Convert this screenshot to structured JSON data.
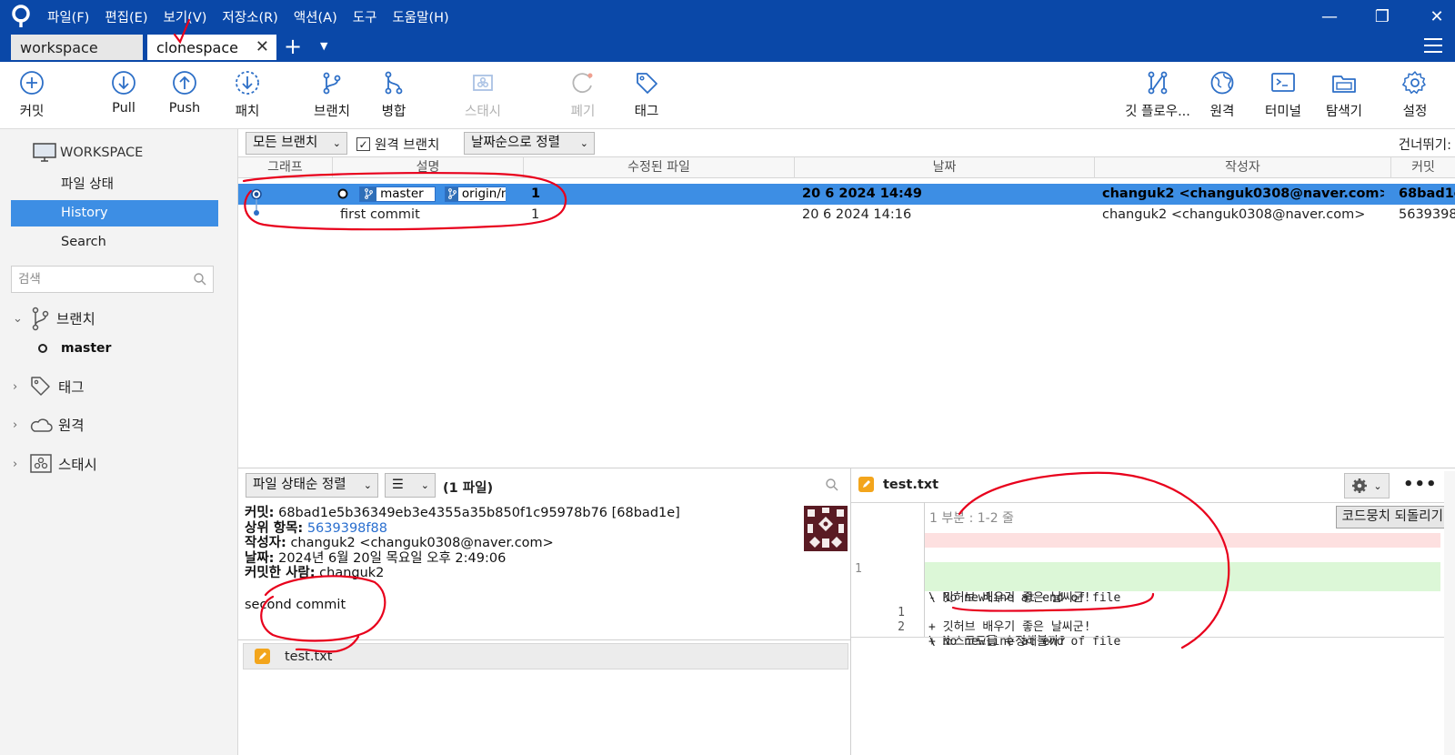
{
  "menu": {
    "items": [
      "파일(F)",
      "편집(E)",
      "보기(V)",
      "저장소(R)",
      "액션(A)",
      "도구",
      "도움말(H)"
    ]
  },
  "window": {
    "minimize": "—",
    "restore": "❐",
    "close": "✕"
  },
  "tabs": {
    "items": [
      {
        "label": "workspace",
        "active": false
      },
      {
        "label": "clonespace",
        "active": true
      }
    ],
    "close_glyph": "✕",
    "add_glyph": "+",
    "dropdown_glyph": "▼"
  },
  "toolbar": {
    "commit": "커밋",
    "pull": "Pull",
    "push": "Push",
    "patch": "패치",
    "branch": "브랜치",
    "merge": "병합",
    "stash": "스태시",
    "discard": "폐기",
    "tag": "태그",
    "gitflow": "깃 플로우...",
    "remote": "원격",
    "terminal": "터미널",
    "explorer": "탐색기",
    "settings": "설정"
  },
  "sidebar": {
    "workspace": "WORKSPACE",
    "items": [
      {
        "label": "파일 상태",
        "active": false
      },
      {
        "label": "History",
        "active": true
      },
      {
        "label": "Search",
        "active": false
      }
    ],
    "search_placeholder": "검색",
    "groups": {
      "branches": "브랜치",
      "tags": "태그",
      "remotes": "원격",
      "stashes": "스태시"
    },
    "branches": [
      "master"
    ]
  },
  "history": {
    "branch_filter": "모든 브랜치",
    "remote_branches": "원격 브랜치",
    "remote_branches_checked": true,
    "sort": "날짜순으로 정렬",
    "jump_to": "건너뛰기:",
    "columns": {
      "graph": "그래프",
      "description": "설명",
      "modified_files": "수정된 파일",
      "date": "날짜",
      "author": "작성자",
      "commit": "커밋"
    },
    "rows": [
      {
        "refs": [
          "master",
          "origin/m"
        ],
        "description": "",
        "files": "1",
        "date": "20 6 2024 14:49",
        "author": "changuk2 <changuk0308@naver.com>",
        "commit": "68bad1e",
        "selected": true
      },
      {
        "refs": [],
        "description": "first commit",
        "files": "1",
        "date": "20 6 2024 14:16",
        "author": "changuk2 <changuk0308@naver.com>",
        "commit": "5639398",
        "selected": false
      }
    ]
  },
  "files": {
    "sort": "파일 상태순 정렬",
    "view_glyph": "☰",
    "count": "(1 파일)",
    "list": [
      "test.txt"
    ]
  },
  "commit_details": {
    "commit_label": "커밋:",
    "commit_value": "68bad1e5b36349eb3e4355a35b850f1c95978b76 [68bad1e]",
    "parent_label": "상위 항목:",
    "parent_value": "5639398f88",
    "author_label": "작성자:",
    "author_value": "changuk2 <changuk0308@naver.com>",
    "date_label": "날짜:",
    "date_value": "2024년 6월 20일 목요일 오후 2:49:06",
    "committer_label": "커밋한 사람:",
    "committer_value": "changuk2",
    "message": "second commit"
  },
  "diff": {
    "file": "test.txt",
    "hunk": "1 부분 : 1-2 줄",
    "revert": "코드뭉치 되돌리기",
    "more_glyph": "•••",
    "lines": [
      {
        "type": "del",
        "old": "1",
        "new": "",
        "text": "- 깃허브 배우기 좋은 날씨군!"
      },
      {
        "type": "meta",
        "old": "",
        "new": "",
        "text": "\\ No newline at end of file"
      },
      {
        "type": "add",
        "old": "",
        "new": "1",
        "text": "+ 깃허브 배우기 좋은 날씨군!"
      },
      {
        "type": "add",
        "old": "",
        "new": "2",
        "text": "+ 소스코드를 수정해볼까?"
      },
      {
        "type": "meta",
        "old": "",
        "new": "",
        "text": "\\ No newline at end of file"
      }
    ]
  },
  "colors": {
    "titlebar": "#0a48a8",
    "selection": "#3d8ee4",
    "annotation": "#e8001c",
    "diff_add": "#dcf7d7",
    "diff_del": "#fde0e0"
  }
}
